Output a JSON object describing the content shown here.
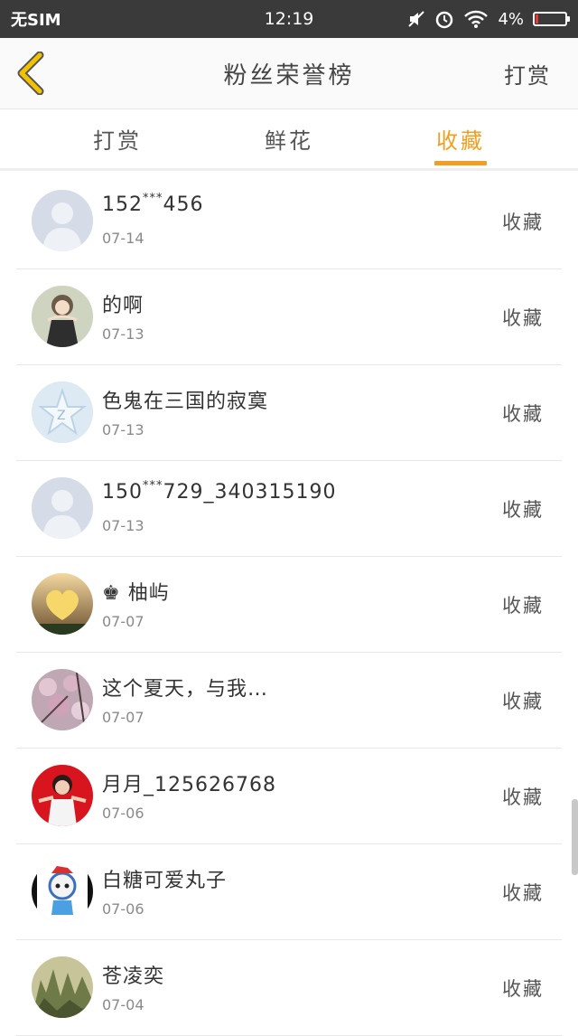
{
  "status_bar": {
    "carrier": "无SIM",
    "time": "12:19",
    "battery": "4%",
    "icons": [
      "mute-icon",
      "alarm-icon",
      "wifi-icon",
      "battery-icon"
    ],
    "battery_level": 0.04
  },
  "header": {
    "title": "粉丝荣誉榜",
    "action_label": "打赏"
  },
  "tabs": [
    {
      "label": "打赏",
      "active": false
    },
    {
      "label": "鲜花",
      "active": false
    },
    {
      "label": "收藏",
      "active": true
    }
  ],
  "colors": {
    "accent": "#f0a020",
    "status_bar": "#3a3a3a",
    "back_icon": "#f2c200"
  },
  "list": [
    {
      "name_prefix": "152",
      "name_sup": "***",
      "name_suffix": "456",
      "date": "07-14",
      "action": "收藏",
      "avatar": "default-avatar"
    },
    {
      "name": "的啊",
      "date": "07-13",
      "action": "收藏",
      "avatar": "anime-girl-avatar"
    },
    {
      "name": "色鬼在三国的寂寞",
      "date": "07-13",
      "action": "收藏",
      "avatar": "qzone-star-avatar"
    },
    {
      "name_prefix": "150",
      "name_sup": "***",
      "name_suffix": "729_340315190",
      "date": "07-13",
      "action": "收藏",
      "avatar": "default-avatar"
    },
    {
      "name": "♚ 柚屿",
      "date": "07-07",
      "action": "收藏",
      "avatar": "heart-sunset-avatar"
    },
    {
      "name": "这个夏天，与我…",
      "date": "07-07",
      "action": "收藏",
      "avatar": "blossom-avatar"
    },
    {
      "name": "月月_125626768",
      "date": "07-06",
      "action": "收藏",
      "avatar": "girl-red-avatar"
    },
    {
      "name": "白糖可爱丸子",
      "date": "07-06",
      "action": "收藏",
      "avatar": "cartoon-cat-avatar"
    },
    {
      "name": "苍凌奕",
      "date": "07-04",
      "action": "收藏",
      "avatar": "mountain-avatar"
    }
  ]
}
